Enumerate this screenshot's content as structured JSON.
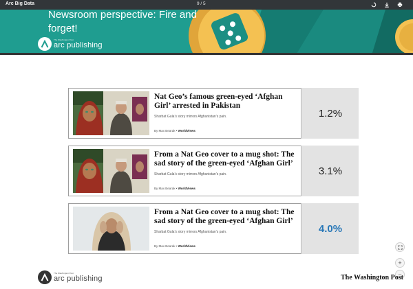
{
  "toolbar": {
    "title": "Arc Big Data",
    "page_indicator": "9 / 5",
    "buttons": [
      "rotate-icon",
      "download-icon",
      "print-icon"
    ]
  },
  "banner": {
    "headline": "Newsroom perspective: Fire and forget!",
    "bg_color": "#1f9d90"
  },
  "logo": {
    "small_text": "The Washington Post",
    "name": "arc publishing"
  },
  "cards": [
    {
      "headline": "Nat Geo’s famous green-eyed ‘Afghan Girl’ arrested in Pakistan",
      "subhead": "Sharbat Gula’s story mirrors Afghanistan’s pain.",
      "byline_prefix": "By Max Bearak",
      "byline_section": "WorldViews",
      "percent": "1.2%"
    },
    {
      "headline": "From a Nat Geo cover to a mug shot: The sad story of the green-eyed ‘Afghan Girl’",
      "subhead": "Sharbat Gula’s story mirrors Afghanistan’s pain.",
      "byline_prefix": "By Max Bearak",
      "byline_section": "WorldViews",
      "percent": "3.1%"
    },
    {
      "headline": "From a Nat Geo cover to a mug shot: The sad story of the green-eyed ‘Afghan Girl’",
      "subhead": "Sharbat Gula’s story mirrors Afghanistan’s pain.",
      "byline_prefix": "By Max Bearak",
      "byline_section": "WorldViews",
      "percent": "4.0%"
    }
  ],
  "footer": {
    "publisher": "The Washington Post"
  },
  "side_controls": [
    "fit-page-icon",
    "+",
    "−"
  ],
  "colors": {
    "accent": "#1f9d90",
    "winner": "#2b79b8",
    "toolbar": "#323639"
  }
}
